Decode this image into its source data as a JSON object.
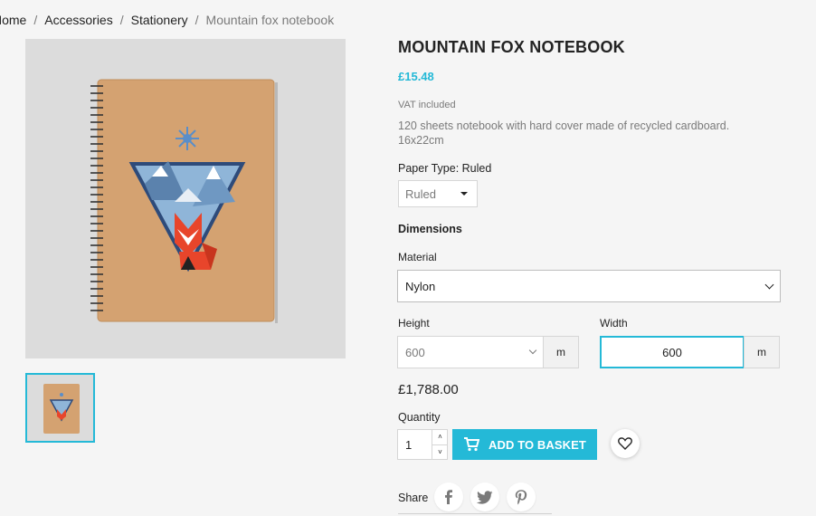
{
  "breadcrumb": {
    "items": [
      "Home",
      "Accessories",
      "Stationery"
    ],
    "separator": "/",
    "current": "Mountain fox notebook"
  },
  "product": {
    "title": "MOUNTAIN FOX NOTEBOOK",
    "price": "£15.48",
    "vat_note": "VAT included",
    "description": "120 sheets notebook with hard cover made of recycled cardboard. 16x22cm"
  },
  "paper_type": {
    "label": "Paper Type: Ruled",
    "selected": "Ruled"
  },
  "dimensions": {
    "heading": "Dimensions",
    "material_label": "Material",
    "material_selected": "Nylon",
    "height_label": "Height",
    "height_selected": "600",
    "height_unit": "m",
    "width_label": "Width",
    "width_value": "600",
    "width_unit": "m"
  },
  "total_price": "£1,788.00",
  "quantity": {
    "label": "Quantity",
    "value": "1",
    "up": "˄",
    "down": "˅"
  },
  "add_to_basket": "ADD TO BASKET",
  "share": {
    "label": "Share"
  },
  "colors": {
    "accent": "#24b9d7",
    "background": "#f5f5f5",
    "cover": "#d4a271",
    "fox": "#e8452b"
  },
  "icons": {
    "cart": "cart-icon",
    "wishlist": "heart-icon",
    "facebook": "facebook-icon",
    "twitter": "twitter-icon",
    "pinterest": "pinterest-icon"
  }
}
